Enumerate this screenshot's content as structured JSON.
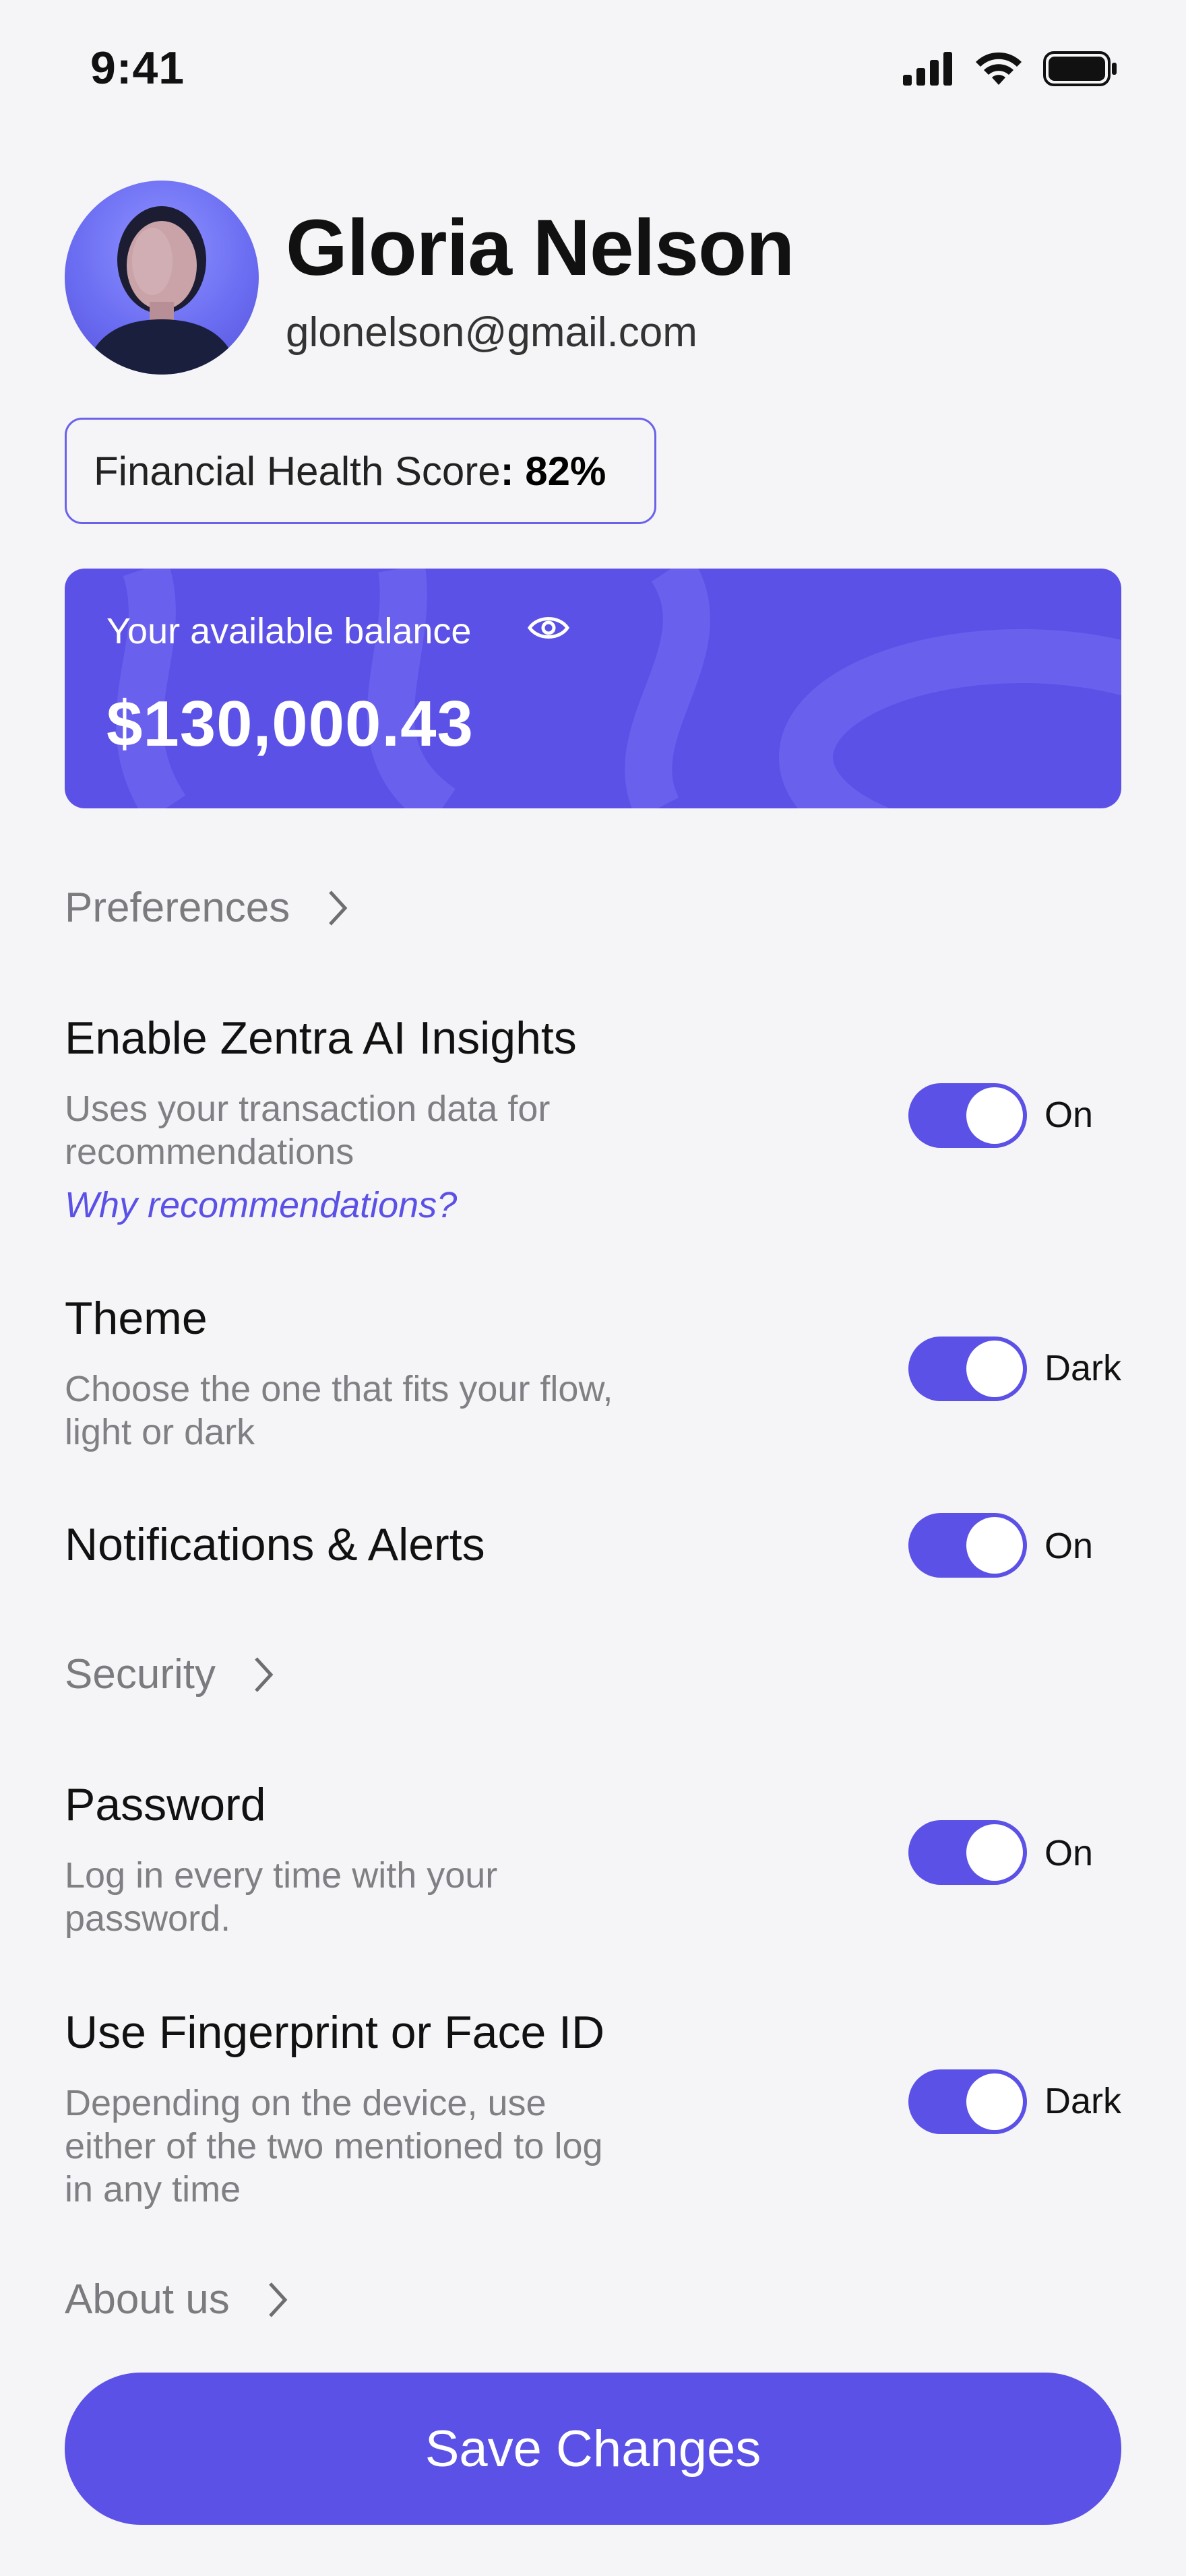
{
  "status_bar": {
    "time": "9:41"
  },
  "profile": {
    "name": "Gloria Nelson",
    "email": "glonelson@gmail.com",
    "score_label": "Financial Health Score",
    "score_value": ": 82%"
  },
  "balance": {
    "label": "Your available balance",
    "amount": "$130,000.43",
    "icon": "eye-icon"
  },
  "sections": {
    "preferences": "Preferences",
    "security": "Security",
    "about": "About us"
  },
  "settings": {
    "ai_insights": {
      "title": "Enable Zentra AI Insights",
      "desc": "Uses your transaction data for recommendations",
      "link": "Why recommendations?",
      "state": "On"
    },
    "theme": {
      "title": "Theme",
      "desc": "Choose the one that fits your flow, light or dark",
      "state": "Dark"
    },
    "notifications": {
      "title": "Notifications & Alerts",
      "state": "On"
    },
    "password": {
      "title": "Password",
      "desc": "Log in every time with your password.",
      "state": "On"
    },
    "biometric": {
      "title": "Use Fingerprint or Face ID",
      "desc": "Depending on the device, use either of the two mentioned to log in any time",
      "state": "Dark"
    }
  },
  "actions": {
    "save": "Save Changes"
  },
  "colors": {
    "accent": "#5b51e6",
    "background": "#f5f5f7",
    "muted_text": "#808084"
  }
}
